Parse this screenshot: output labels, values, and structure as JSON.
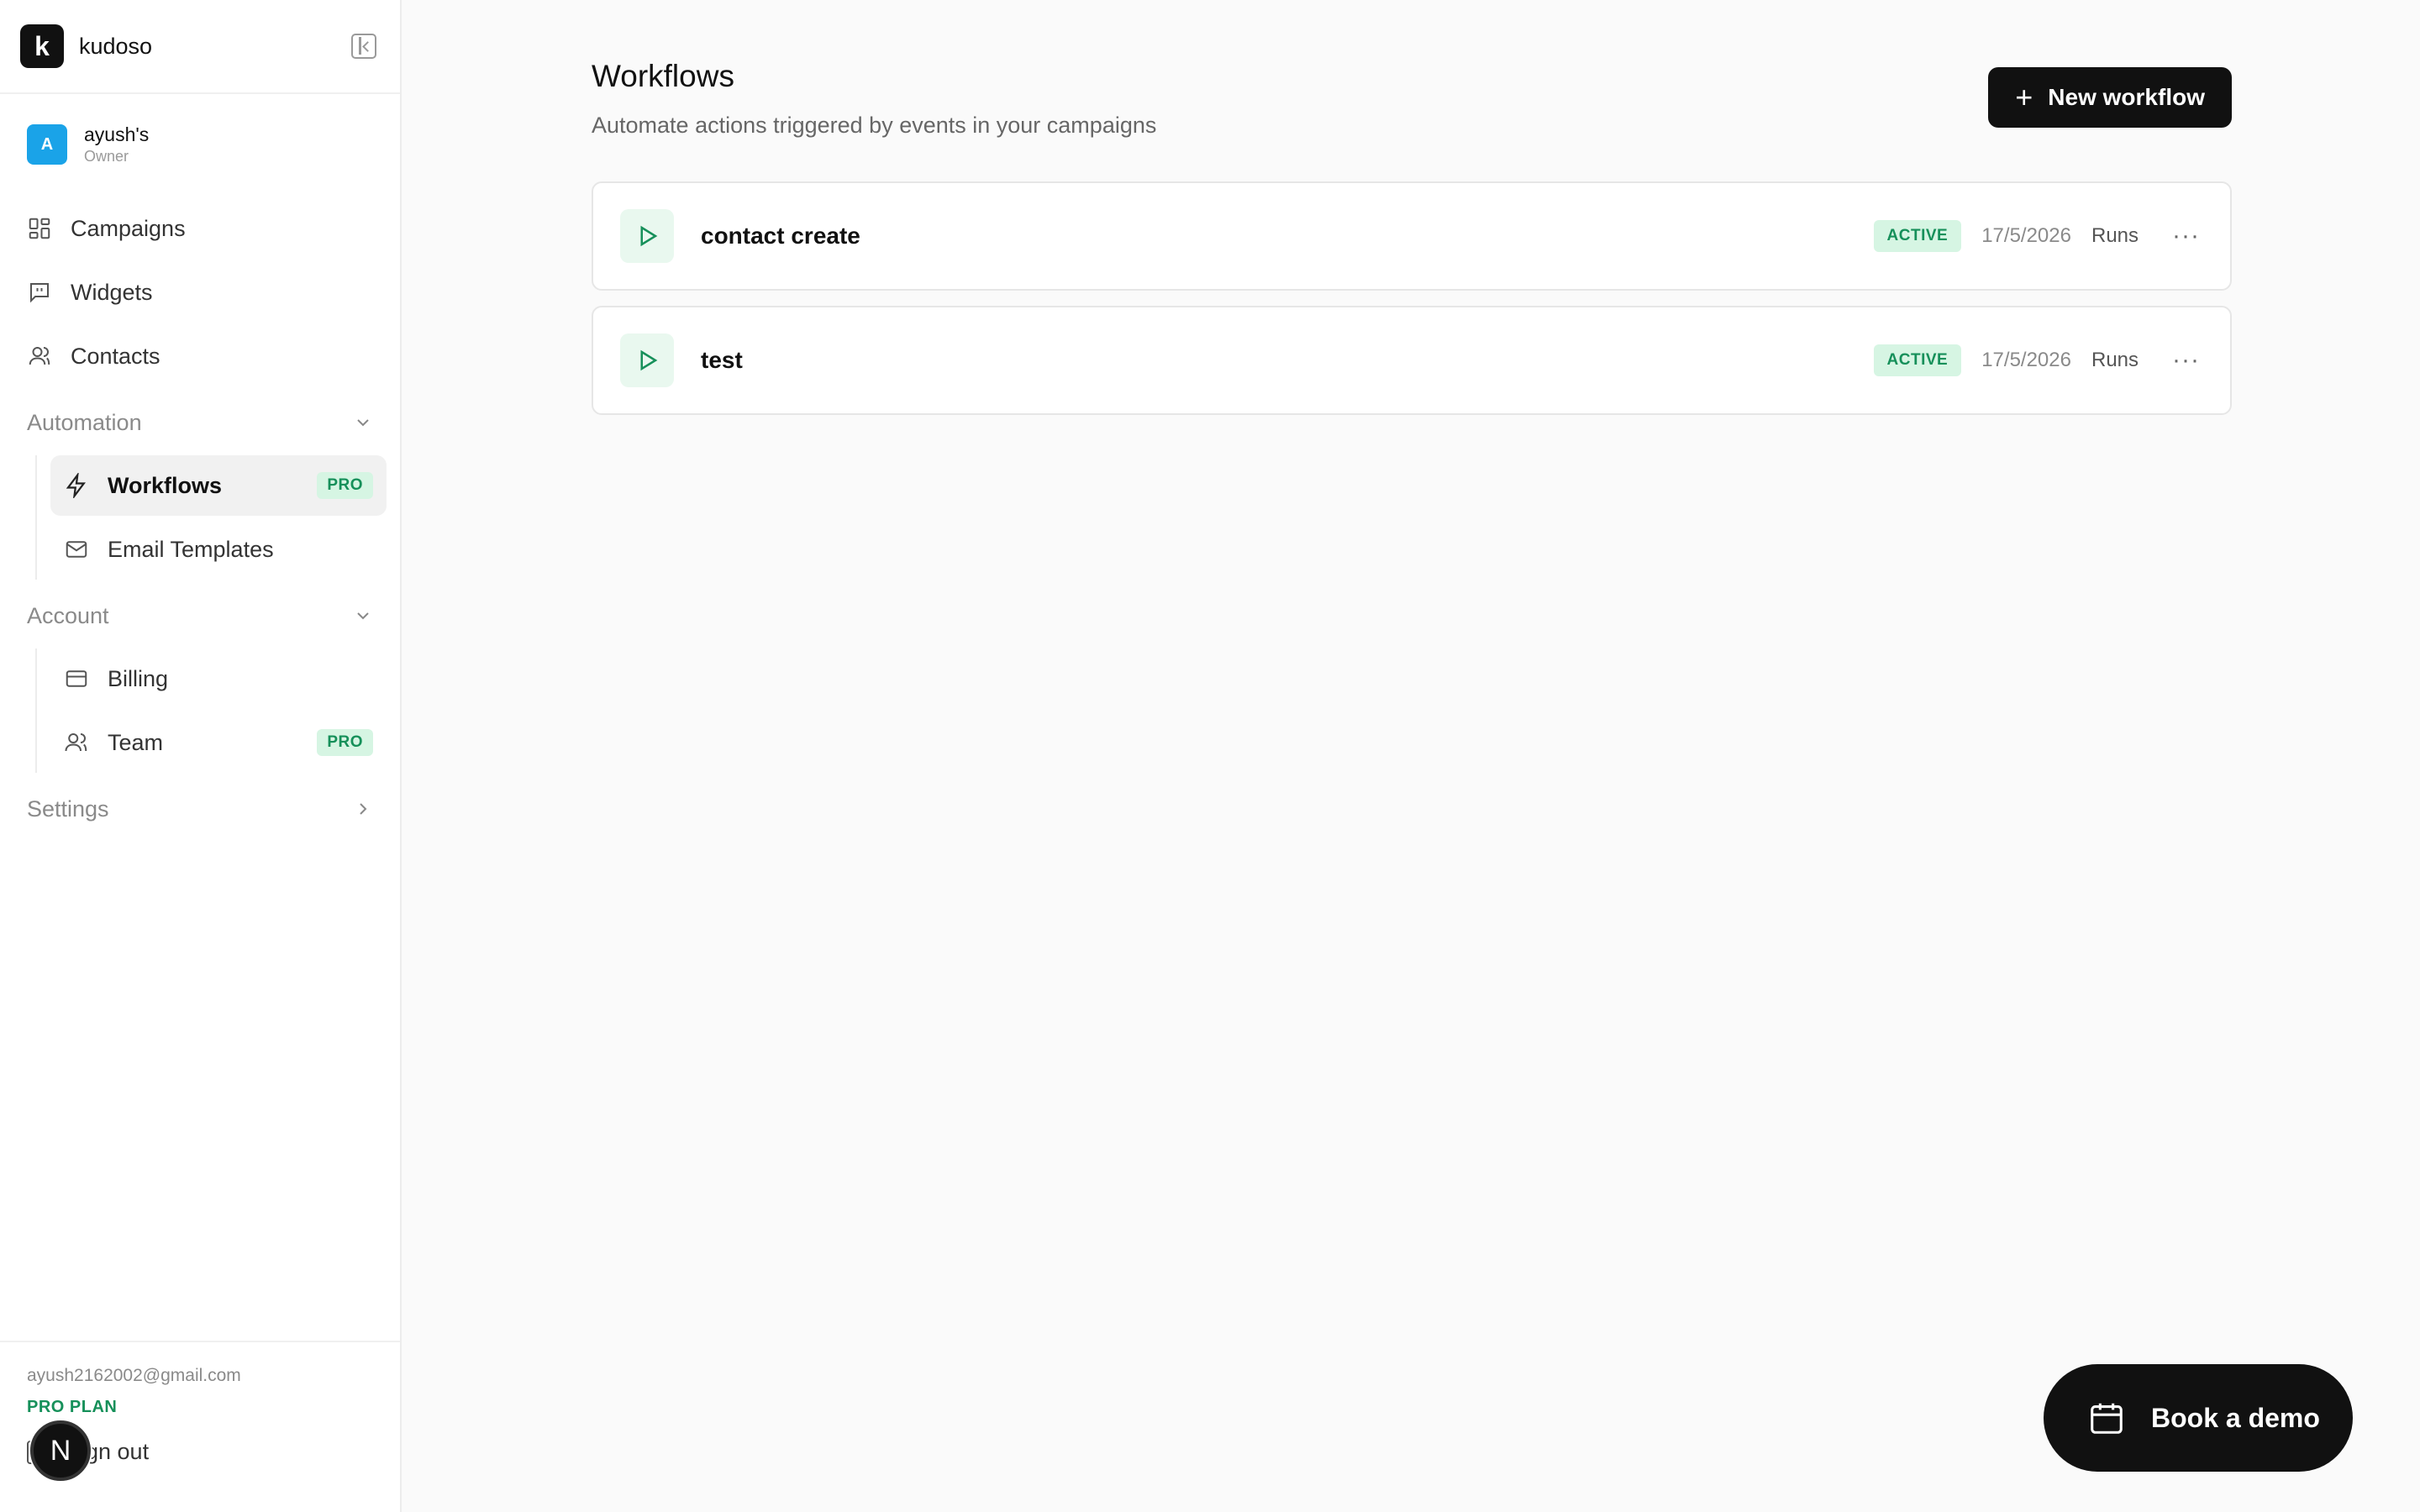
{
  "brand": {
    "logo_letter": "k",
    "name": "kudoso"
  },
  "account": {
    "avatar_letter": "A",
    "name": "ayush's",
    "role": "Owner"
  },
  "nav": [
    {
      "label": "Campaigns",
      "icon": "grid-icon"
    },
    {
      "label": "Widgets",
      "icon": "message-square-icon"
    },
    {
      "label": "Contacts",
      "icon": "user-icon"
    }
  ],
  "sections": {
    "automation": {
      "title": "Automation",
      "items": [
        {
          "label": "Workflows",
          "icon": "zap-icon",
          "badge": "PRO",
          "active": true
        },
        {
          "label": "Email Templates",
          "icon": "mail-icon"
        }
      ]
    },
    "account": {
      "title": "Account",
      "items": [
        {
          "label": "Billing",
          "icon": "credit-card-icon"
        },
        {
          "label": "Team",
          "icon": "users-icon",
          "badge": "PRO"
        }
      ]
    },
    "settings": {
      "title": "Settings"
    }
  },
  "footer": {
    "email": "ayush2162002@gmail.com",
    "plan": "PRO PLAN",
    "signout": "Sign out",
    "dev_badge": "N"
  },
  "page": {
    "title": "Workflows",
    "subtitle": "Automate actions triggered by events in your campaigns",
    "new_button": "New workflow",
    "new_button_icon": "+"
  },
  "workflows": [
    {
      "name": "contact create",
      "status": "ACTIVE",
      "date": "17/5/2026",
      "runs": "Runs",
      "more": "···"
    },
    {
      "name": "test",
      "status": "ACTIVE",
      "date": "17/5/2026",
      "runs": "Runs",
      "more": "···"
    }
  ],
  "demo_button": {
    "label": "Book a demo",
    "icon": "calendar-icon"
  },
  "colors": {
    "accent_green": "#16905a",
    "badge_bg": "#d6f5e3",
    "primary": "#111111",
    "avatar": "#1aa3e8"
  }
}
